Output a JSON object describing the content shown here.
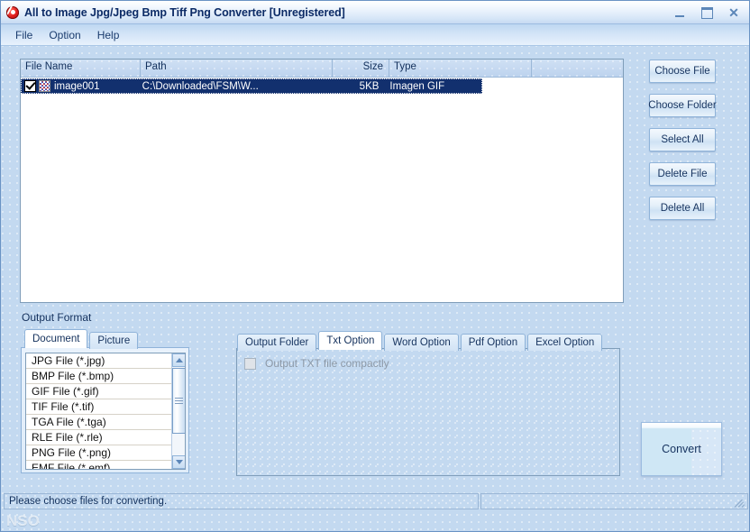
{
  "window": {
    "title": "All to Image Jpg/Jpeg Bmp Tiff Png Converter [Unregistered]",
    "icon": "app-logo-icon",
    "controls": {
      "minimize": "minimize-icon",
      "maximize": "maximize-icon",
      "close": "close-icon"
    }
  },
  "menu": {
    "items": [
      {
        "label": "File"
      },
      {
        "label": "Option"
      },
      {
        "label": "Help"
      }
    ]
  },
  "file_list": {
    "columns": [
      {
        "label": "File Name"
      },
      {
        "label": "Path"
      },
      {
        "label": "Size"
      },
      {
        "label": "Type"
      }
    ],
    "rows": [
      {
        "checked": true,
        "name": "image001",
        "path": "C:\\Downloaded\\FSM\\W...",
        "size": "5KB",
        "type": "Imagen GIF"
      }
    ]
  },
  "side_buttons": [
    {
      "label": "Choose File"
    },
    {
      "label": "Choose Folder"
    },
    {
      "label": "Select All"
    },
    {
      "label": "Delete File"
    },
    {
      "label": "Delete All"
    }
  ],
  "output_format": {
    "group_label": "Output Format",
    "tabs": [
      {
        "label": "Document",
        "active": false
      },
      {
        "label": "Picture",
        "active": true
      }
    ],
    "formats": [
      {
        "label": "JPG File  (*.jpg)"
      },
      {
        "label": "BMP File  (*.bmp)"
      },
      {
        "label": "GIF File  (*.gif)"
      },
      {
        "label": "TIF File  (*.tif)"
      },
      {
        "label": "TGA File  (*.tga)"
      },
      {
        "label": "RLE File  (*.rle)"
      },
      {
        "label": "PNG File  (*.png)"
      },
      {
        "label": "EMF File  (*.emf)"
      }
    ]
  },
  "options": {
    "tabs": [
      {
        "label": "Output Folder",
        "active": false
      },
      {
        "label": "Txt Option",
        "active": true
      },
      {
        "label": "Word Option",
        "active": false
      },
      {
        "label": "Pdf Option",
        "active": false
      },
      {
        "label": "Excel Option",
        "active": false
      }
    ],
    "txt_option": {
      "checkbox_label": "Output TXT file compactly",
      "checked": false,
      "enabled": false
    }
  },
  "convert": {
    "label": "Convert"
  },
  "status_bar": {
    "message": "Please choose files for converting.",
    "secondary": ""
  },
  "watermark": {
    "text": "NSO"
  },
  "colors": {
    "background": "#c3d9f0",
    "title_text": "#0c2b66",
    "selection": "#12306e",
    "panel_border": "#7f9db9",
    "accent": "#5b86b8"
  }
}
